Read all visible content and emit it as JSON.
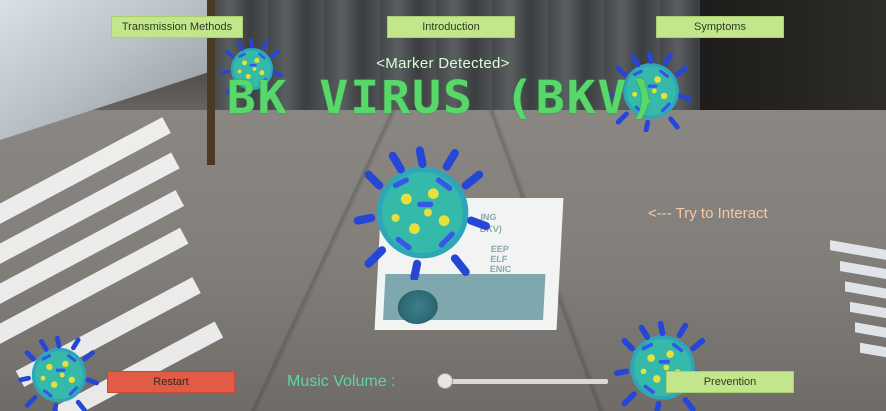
{
  "top_buttons": {
    "transmission": "Transmission Methods",
    "introduction": "Introduction",
    "symptoms": "Symptoms"
  },
  "marker_status": "<Marker Detected>",
  "title": "BK VIRUS (BKV)",
  "hint": "<--- Try to Interact",
  "bottom": {
    "restart": "Restart",
    "volume_label": "Music Volume :",
    "volume_value": 0.0,
    "prevention": "Prevention"
  },
  "poster": {
    "line1": "ING",
    "line2": "BKV)",
    "line3": "EEP",
    "line4": "ELF",
    "line5": "ENIC"
  },
  "colors": {
    "button_green": "#c3e68d",
    "button_red": "#e25b45",
    "title_green": "#58d86a",
    "hint_orange": "#f6c8a4",
    "volume_label": "#5ed6a4"
  },
  "icons": {
    "virus": "bk-virus-3d-model"
  }
}
